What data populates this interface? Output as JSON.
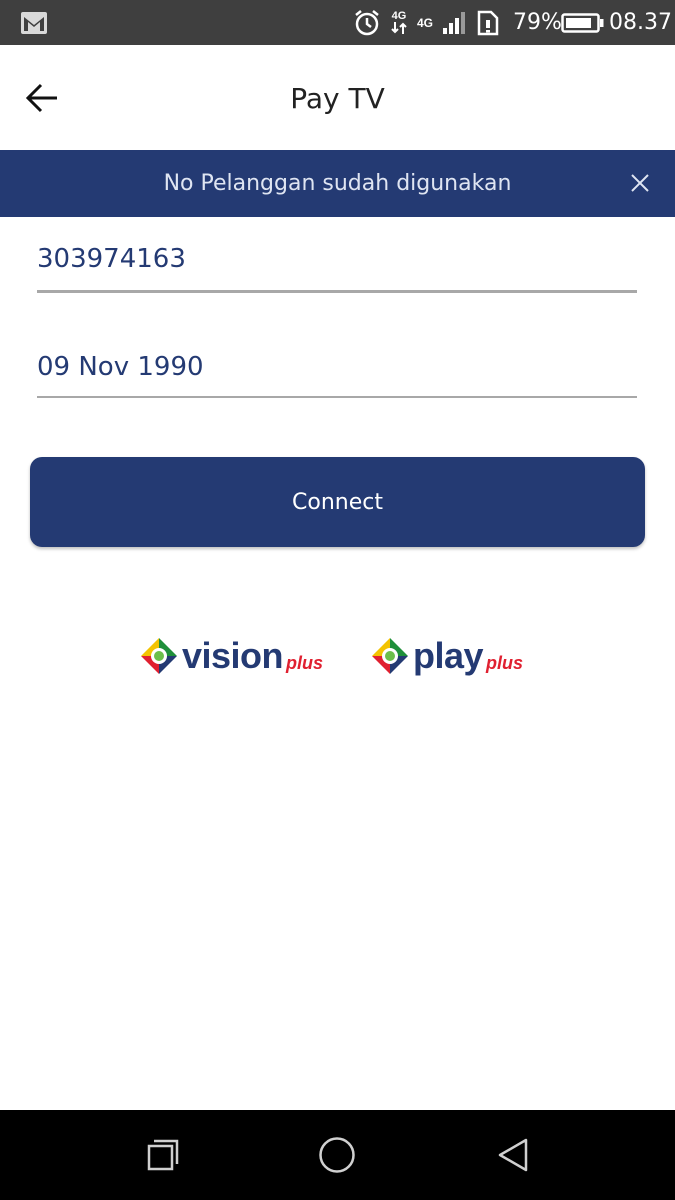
{
  "status_bar": {
    "battery_percent": "79%",
    "time": "08.37",
    "network_label_1": "4G",
    "network_label_2": "4G",
    "icons": [
      "gmail-icon",
      "alarm-icon",
      "data-4g-icon",
      "lte-4g-icon",
      "signal-icon",
      "sim-icon",
      "battery-icon"
    ]
  },
  "header": {
    "title": "Pay TV",
    "back_icon": "arrow-left-icon"
  },
  "banner": {
    "message": "No Pelanggan sudah digunakan",
    "close_icon": "close-icon",
    "color": "#243a73"
  },
  "form": {
    "customer_number": "303974163",
    "birth_date": "09 Nov 1990",
    "connect_label": "Connect"
  },
  "logos": {
    "vision_word": "vision",
    "vision_suffix": "plus",
    "play_word": "play",
    "play_suffix": "plus"
  },
  "nav_bar": {
    "icons": [
      "recents-icon",
      "home-icon",
      "back-icon"
    ]
  },
  "colors": {
    "primary": "#243a73",
    "status_bar": "#3f3f3f",
    "accent_red": "#e02030"
  }
}
